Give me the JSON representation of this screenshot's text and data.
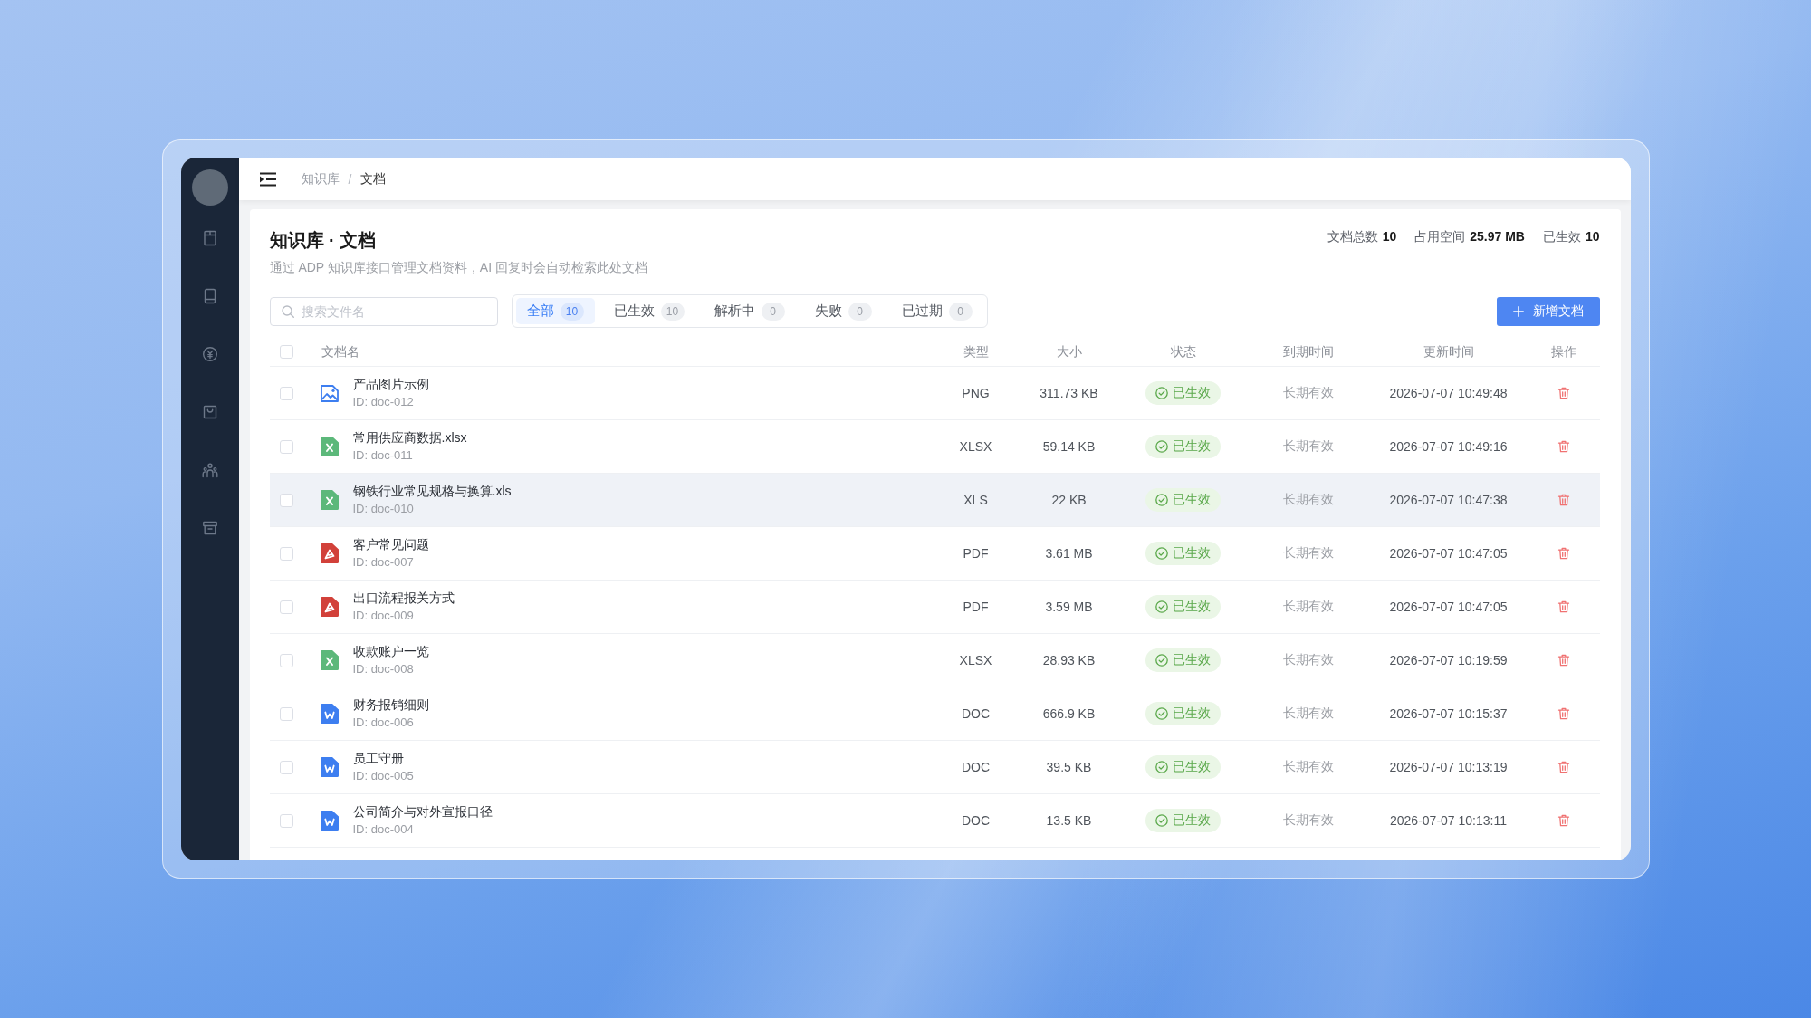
{
  "header": {
    "breadcrumb": {
      "separator": "/",
      "items": [
        {
          "label": "知识库",
          "current": false
        },
        {
          "label": "文档",
          "current": true
        }
      ]
    }
  },
  "page": {
    "title": "知识库 · 文档",
    "subtitle": "通过 ADP 知识库接口管理文档资料，AI 回复时会自动检索此处文档",
    "stats": [
      {
        "label": "文档总数",
        "value": "10"
      },
      {
        "label": "占用空间",
        "value": "25.97 MB"
      },
      {
        "label": "已生效",
        "value": "10"
      }
    ]
  },
  "toolbar": {
    "search": {
      "placeholder": "搜索文件名"
    },
    "filters": [
      {
        "label": "全部",
        "count": "10",
        "selected": true
      },
      {
        "label": "已生效",
        "count": "10",
        "selected": false
      },
      {
        "label": "解析中",
        "count": "0",
        "selected": false
      },
      {
        "label": "失败",
        "count": "0",
        "selected": false
      },
      {
        "label": "已过期",
        "count": "0",
        "selected": false
      }
    ],
    "add_button": {
      "label": "新增文档"
    }
  },
  "table": {
    "select_all": {
      "checked": false
    },
    "columns": [
      "文档名",
      "类型",
      "大小",
      "状态",
      "到期时间",
      "更新时间",
      "操作"
    ],
    "rows": [
      {
        "kind": "image",
        "name": "产品图片示例",
        "id": "ID: doc-012",
        "type": "PNG",
        "size": "311.73 KB",
        "status": "已生效",
        "expiry": "长期有效",
        "updated": "2026-07-07 10:49:48",
        "checked": false,
        "highlighted": false
      },
      {
        "kind": "spreadsheet",
        "name": "常用供应商数据.xlsx",
        "id": "ID: doc-011",
        "type": "XLSX",
        "size": "59.14 KB",
        "status": "已生效",
        "expiry": "长期有效",
        "updated": "2026-07-07 10:49:16",
        "checked": false,
        "highlighted": false
      },
      {
        "kind": "spreadsheet",
        "name": "钢铁行业常见规格与换算.xls",
        "id": "ID: doc-010",
        "type": "XLS",
        "size": "22 KB",
        "status": "已生效",
        "expiry": "长期有效",
        "updated": "2026-07-07 10:47:38",
        "checked": false,
        "highlighted": true
      },
      {
        "kind": "pdf",
        "name": "客户常见问题",
        "id": "ID: doc-007",
        "type": "PDF",
        "size": "3.61 MB",
        "status": "已生效",
        "expiry": "长期有效",
        "updated": "2026-07-07 10:47:05",
        "checked": false,
        "highlighted": false
      },
      {
        "kind": "pdf",
        "name": "出口流程报关方式",
        "id": "ID: doc-009",
        "type": "PDF",
        "size": "3.59 MB",
        "status": "已生效",
        "expiry": "长期有效",
        "updated": "2026-07-07 10:47:05",
        "checked": false,
        "highlighted": false
      },
      {
        "kind": "spreadsheet",
        "name": "收款账户一览",
        "id": "ID: doc-008",
        "type": "XLSX",
        "size": "28.93 KB",
        "status": "已生效",
        "expiry": "长期有效",
        "updated": "2026-07-07 10:19:59",
        "checked": false,
        "highlighted": false
      },
      {
        "kind": "word",
        "name": "财务报销细则",
        "id": "ID: doc-006",
        "type": "DOC",
        "size": "666.9 KB",
        "status": "已生效",
        "expiry": "长期有效",
        "updated": "2026-07-07 10:15:37",
        "checked": false,
        "highlighted": false
      },
      {
        "kind": "word",
        "name": "员工守册",
        "id": "ID: doc-005",
        "type": "DOC",
        "size": "39.5 KB",
        "status": "已生效",
        "expiry": "长期有效",
        "updated": "2026-07-07 10:13:19",
        "checked": false,
        "highlighted": false
      },
      {
        "kind": "word",
        "name": "公司简介与对外宣报口径",
        "id": "ID: doc-004",
        "type": "DOC",
        "size": "13.5 KB",
        "status": "已生效",
        "expiry": "长期有效",
        "updated": "2026-07-07 10:13:11",
        "checked": false,
        "highlighted": false
      }
    ]
  }
}
